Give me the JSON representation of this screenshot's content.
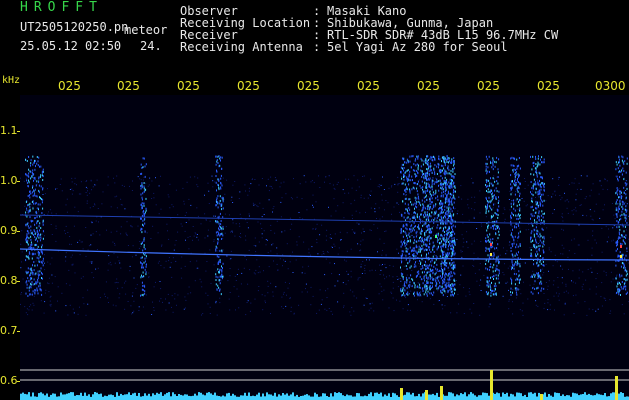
{
  "header": {
    "title": "HROFFT",
    "filename": "UT2505120250.pn",
    "mode": "meteor",
    "datetime": "25.05.12 02:50",
    "number": "24."
  },
  "meta": [
    {
      "label": "Observer",
      "value": "Masaki Kano"
    },
    {
      "label": "Receiving Location",
      "value": "Shibukawa, Gunma, Japan"
    },
    {
      "label": "Receiver",
      "value": "RTL-SDR SDR# 43dB L15 96.7MHz CW"
    },
    {
      "label": "Receiving Antenna",
      "value": "5el Yagi Az 280 for Seoul"
    }
  ],
  "separator": ":",
  "y_axis": {
    "unit": "kHz",
    "ticks": [
      "1.1",
      "1.0",
      "0.9",
      "0.8",
      "0.7",
      "0.6"
    ]
  },
  "x_axis": {
    "ticks": [
      "025",
      "025",
      "025",
      "025",
      "025",
      "025",
      "025",
      "025",
      "025",
      "0300"
    ]
  },
  "colors": {
    "header_green": "#36d64a",
    "axis_yellow": "#e6e62e",
    "text_white": "#e8e8e8",
    "signal_blue": "#2a5cff",
    "signal_cyan": "#3fd0ff"
  }
}
